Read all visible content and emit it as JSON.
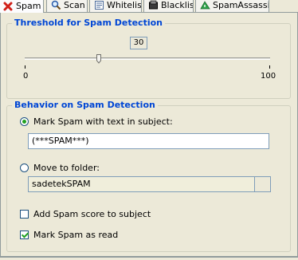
{
  "tabs": [
    {
      "label": "Spam",
      "icon": "red-x-icon",
      "active": true
    },
    {
      "label": "Scan",
      "icon": "magnifier-icon",
      "active": false
    },
    {
      "label": "Whitelist",
      "icon": "whitelist-icon",
      "active": false
    },
    {
      "label": "Blacklist",
      "icon": "blacklist-icon",
      "active": false
    },
    {
      "label": "SpamAssassin",
      "icon": "spamassassin-icon",
      "active": false
    }
  ],
  "threshold": {
    "title": "Threshold for Spam Detection",
    "value": "30",
    "slider_level": 30,
    "min_label": "0",
    "max_label": "100"
  },
  "behavior": {
    "title": "Behavior on Spam Detection",
    "mark_subject": {
      "label": "Mark Spam with text in subject:",
      "selected": true,
      "value": "(***SPAM***)"
    },
    "move_folder": {
      "label": "Move to folder:",
      "selected": false,
      "value": "sadetekSPAM"
    },
    "add_score": {
      "label": "Add Spam score to subject",
      "checked": false
    },
    "mark_read": {
      "label": "Mark Spam as read",
      "checked": true
    }
  },
  "colors": {
    "group_title": "#0046d5",
    "tab_hot": "#e6a03c",
    "check": "#21a121"
  }
}
